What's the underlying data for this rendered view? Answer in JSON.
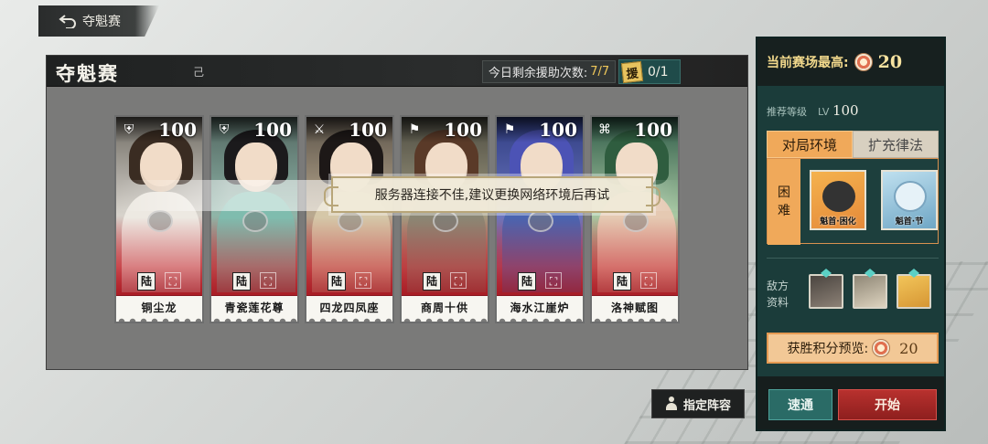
{
  "back_tab": {
    "label": "夺魁赛",
    "icon": "back-arrow-icon"
  },
  "main": {
    "title": "夺魁赛",
    "subtitle": "己",
    "assist_label": "今日剩余援助次数:",
    "assist_count": "7/7",
    "yuan_badge": "援",
    "yuan_count": "0/1"
  },
  "cards": [
    {
      "level": "100",
      "tag": "陆",
      "name": "铜尘龙",
      "class_icon": "shield-icon"
    },
    {
      "level": "100",
      "tag": "陆",
      "name": "青瓷莲花尊",
      "class_icon": "shield-icon"
    },
    {
      "level": "100",
      "tag": "陆",
      "name": "四龙四凤座",
      "class_icon": "sword-icon"
    },
    {
      "level": "100",
      "tag": "陆",
      "name": "商周十供",
      "class_icon": "flag-icon"
    },
    {
      "level": "100",
      "tag": "陆",
      "name": "海水江崖炉",
      "class_icon": "flag-icon"
    },
    {
      "level": "100",
      "tag": "陆",
      "name": "洛神赋图",
      "class_icon": "knot-icon"
    }
  ],
  "toast": {
    "message": "服务器连接不佳,建议更换网络环境后再试"
  },
  "side": {
    "best_label": "当前赛场最高:",
    "best_score": "20",
    "rec_label": "推荐等级",
    "rec_lv_prefix": "LV",
    "rec_lv": "100",
    "tabs": [
      "对局环境",
      "扩充律法"
    ],
    "difficulty": [
      "困",
      "难"
    ],
    "buffs": [
      "魁首·困化",
      "魁首·节"
    ],
    "enemy_label": "敌方资料",
    "win_label": "获胜积分预览:",
    "win_score": "20",
    "sweep": "速通",
    "start": "开始"
  },
  "lineup_button": "指定阵容",
  "colors": {
    "panel_teal": "#1b3c3a",
    "accent_orange": "#f0a95a",
    "start_red": "#b8312e",
    "gold": "#f2d98c"
  }
}
